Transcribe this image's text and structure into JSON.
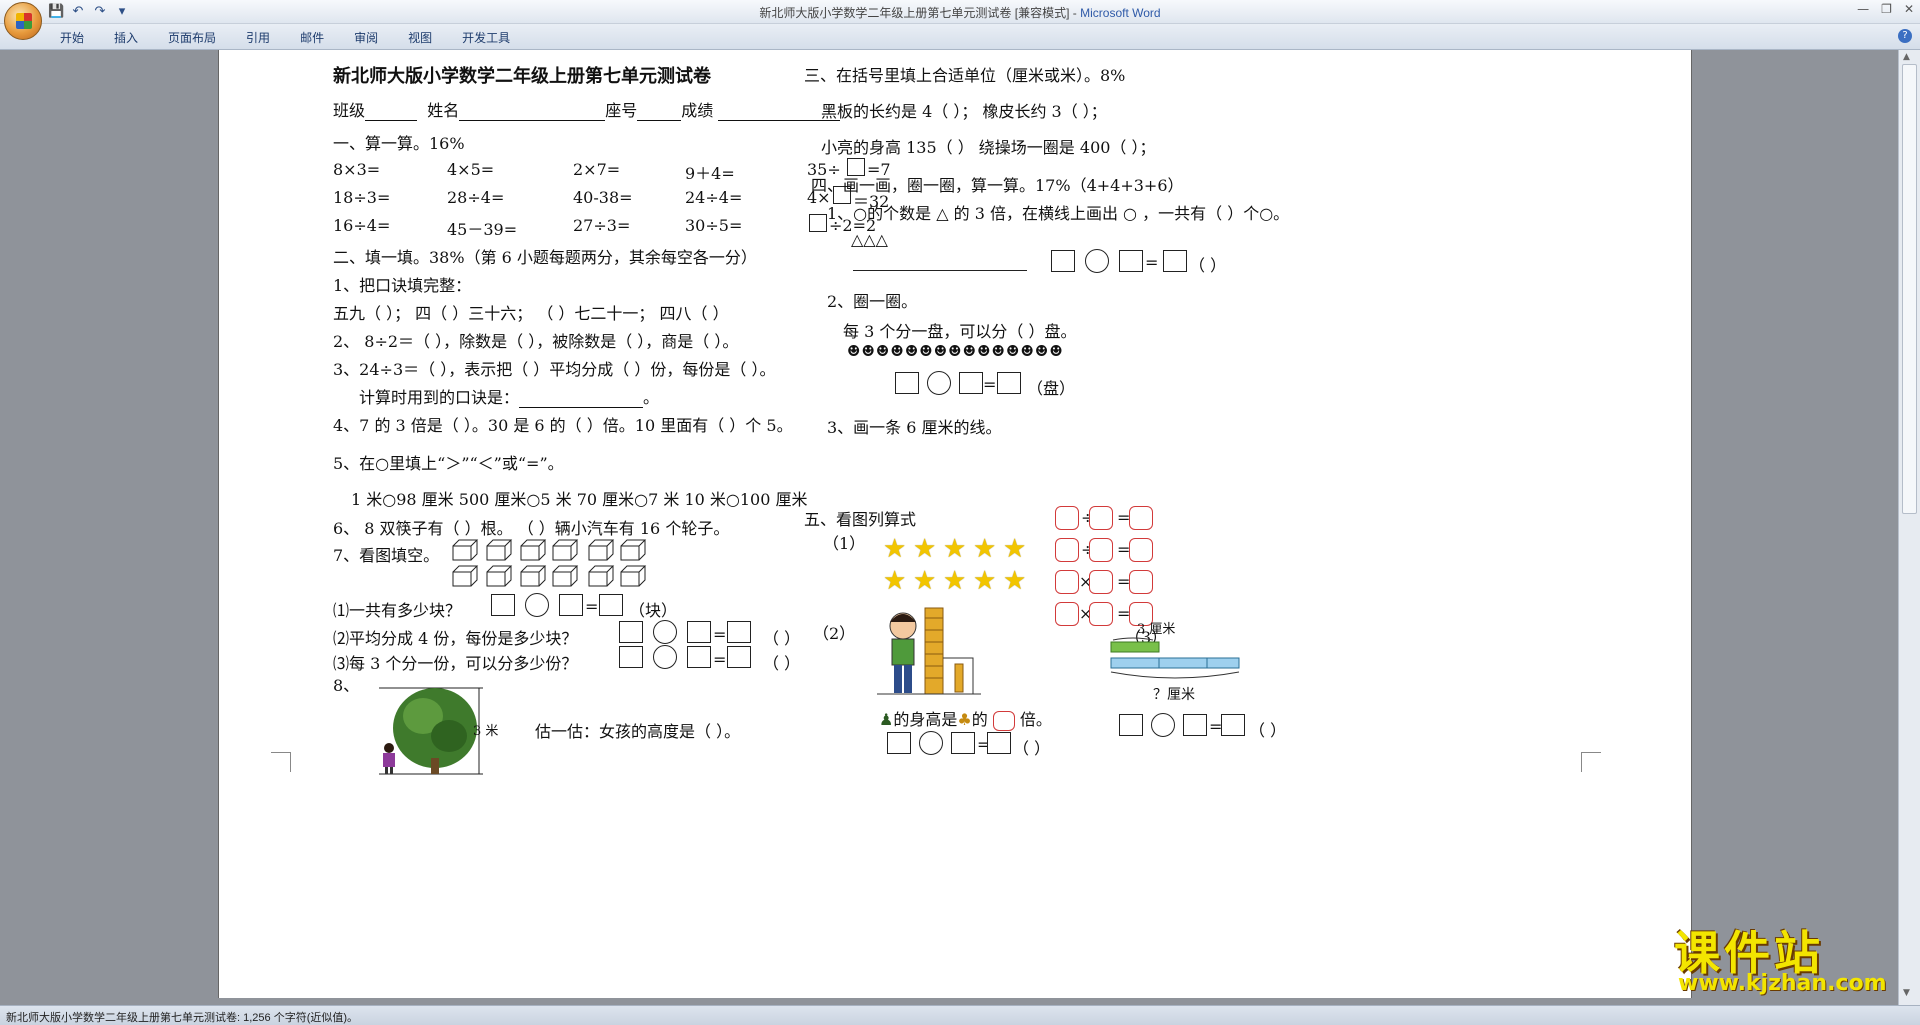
{
  "window": {
    "title": "新北师大版小学数学二年级上册第七单元测试卷 [兼容模式]",
    "app_name": "Microsoft Word",
    "separator": " - "
  },
  "quick_access": [
    "save-icon",
    "undo-icon",
    "redo-icon",
    "customize-icon"
  ],
  "ribbon_tabs": [
    "开始",
    "插入",
    "页面布局",
    "引用",
    "邮件",
    "审阅",
    "视图",
    "开发工具"
  ],
  "status_bar": {
    "text": "新北师大版小学数学二年级上册第七单元测试卷: 1,256 个字符(近似值)。"
  },
  "doc": {
    "title": "新北师大版小学数学二年级上册第七单元测试卷",
    "info": {
      "class_label": "班级",
      "name_label": "姓名",
      "seat_label": "座号",
      "score_label": "成绩"
    },
    "s1": {
      "heading": "一、算一算。16%",
      "rows": [
        [
          "8×3=",
          "4×5=",
          "2×7=",
          "9＋4=",
          "35÷",
          "=7"
        ],
        [
          "18÷3=",
          "28÷4=",
          "40-38=",
          "24÷4=",
          "4×",
          "＝32"
        ],
        [
          "16÷4=",
          "45－39=",
          "27÷3=",
          "30÷5=",
          "",
          "÷2=2"
        ]
      ]
    },
    "s2": {
      "heading": "二、填一填。38%（第 6 小题每题两分，其余每空各一分）",
      "q1": "1、把口诀填完整：",
      "q1a": "五九（        ）；  四（  ）三十六；  （  ）七二十一；  四八（        ）",
      "q2": "2、  8÷2＝（  ），除数是（  ），被除数是（  ），商是（  ）。",
      "q3": "3、24÷3＝（  ），表示把（  ）平均分成（  ）份，每份是（  ）。",
      "q3b": "计算时用到的口诀是：",
      "q3b_end": "。",
      "q4": "4、7 的 3 倍是（      ）。30 是 6 的（      ）倍。10 里面有（      ）个 5。",
      "q5": "5、在○里填上“＞”“＜”或“=”。",
      "q5a": "1 米○98 厘米   500 厘米○5 米    70 厘米○7 米    10 米○100 厘米",
      "q6": "6、  8 双筷子有（      ）根。        （      ）辆小汽车有 16 个轮子。",
      "q7": "7、看图填空。",
      "q7a": "⑴一共有多少块？",
      "q7a_unit": "（块）",
      "q7b": "⑵平均分成 4 份，每份是多少块？",
      "q7c": "⑶每 3 个分一份，可以分多少份？",
      "paren": "（      ）",
      "q8": "8、",
      "q8_height": "3 米",
      "q8_text": "估一估：女孩的高度是（              ）。"
    },
    "s3": {
      "heading": "三、在括号里填上合适单位（厘米或米）。8%",
      "row1": "黑板的长约是 4（        ）；      橡皮长约 3（          ）；",
      "row2": "小亮的身高 135（         ）       绕操场一圈是 400（         ）；"
    },
    "s4": {
      "heading": "四、画一画，圈一圈，算一算。17%（4+4+3+6）",
      "q1": "1、○的个数是 △  的 3 倍，在横线上画出 ○ ，一共有（   ）个○。",
      "q1_shapes": "△△△",
      "q1_paren": "（  ）",
      "q2": "2、圈一圈。",
      "q2a": "每 3 个分一盘，可以分（      ）盘。",
      "q2_unit": "（盘）",
      "q3": "3、画一条 6 厘米的线。"
    },
    "s5": {
      "heading": "五、看图列算式",
      "p1": "（1）",
      "p2": "（2）",
      "p2_text_a": "的身高是",
      "p2_text_b": "的",
      "p2_text_c": "倍。",
      "p3": "（3）",
      "p3_top": "3 厘米",
      "p3_bottom": "？厘米",
      "paren": "（      ）"
    },
    "ops": [
      "÷",
      "÷",
      "×",
      "×"
    ],
    "eq": "="
  },
  "watermark": {
    "text": "课件站",
    "url": "www.kjzhan.com"
  },
  "colors": {
    "page": "#ffffff",
    "background": "#8e9197",
    "accent": "#2f5aa8",
    "star": "#f2c500",
    "red_box": "#d23a3a"
  }
}
